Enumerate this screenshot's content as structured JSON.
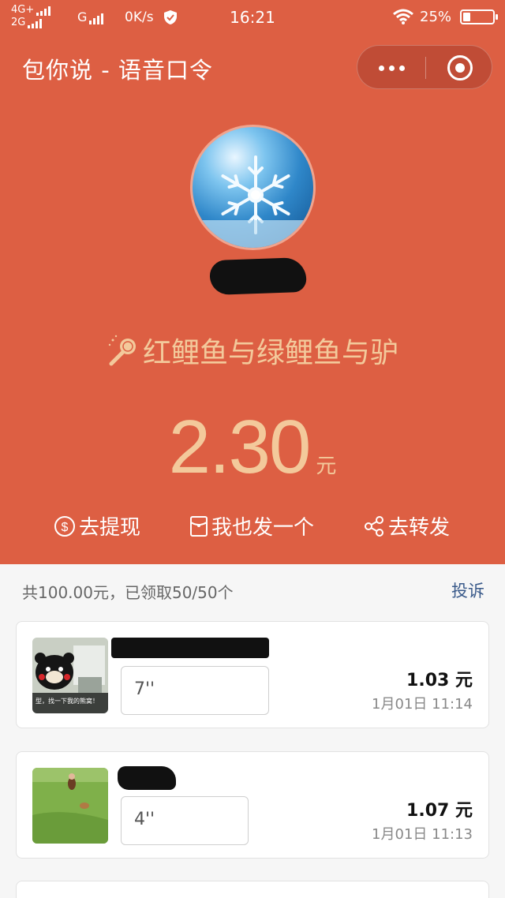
{
  "status_bar": {
    "network_top": "4G+",
    "network_bottom": "2G",
    "network_g": "G",
    "speed": "0K/s",
    "time": "16:21",
    "battery": "25%",
    "battery_level": 0.25
  },
  "nav": {
    "title": "包你说 - 语音口令"
  },
  "header": {
    "phrase": "红鲤鱼与绿鲤鱼与驴",
    "amount": "2.30",
    "amount_unit": "元",
    "actions": [
      {
        "label": "去提现",
        "icon": "dollar-circle-icon"
      },
      {
        "label": "我也发一个",
        "icon": "red-packet-icon"
      },
      {
        "label": "去转发",
        "icon": "share-icon"
      }
    ]
  },
  "summary": {
    "total_text": "共100.00元，已领取50/50个",
    "report": "投诉"
  },
  "records": [
    {
      "duration": "7''",
      "amount": "1.03 元",
      "time": "1月01日 11:14",
      "thumb_caption": "型，找一下我的熊窝！"
    },
    {
      "duration": "4''",
      "amount": "1.07 元",
      "time": "1月01日 11:13"
    }
  ],
  "colors": {
    "header_bg": "#dd5f43",
    "gold_text": "#f3c99b",
    "link": "#3a5a8a"
  }
}
